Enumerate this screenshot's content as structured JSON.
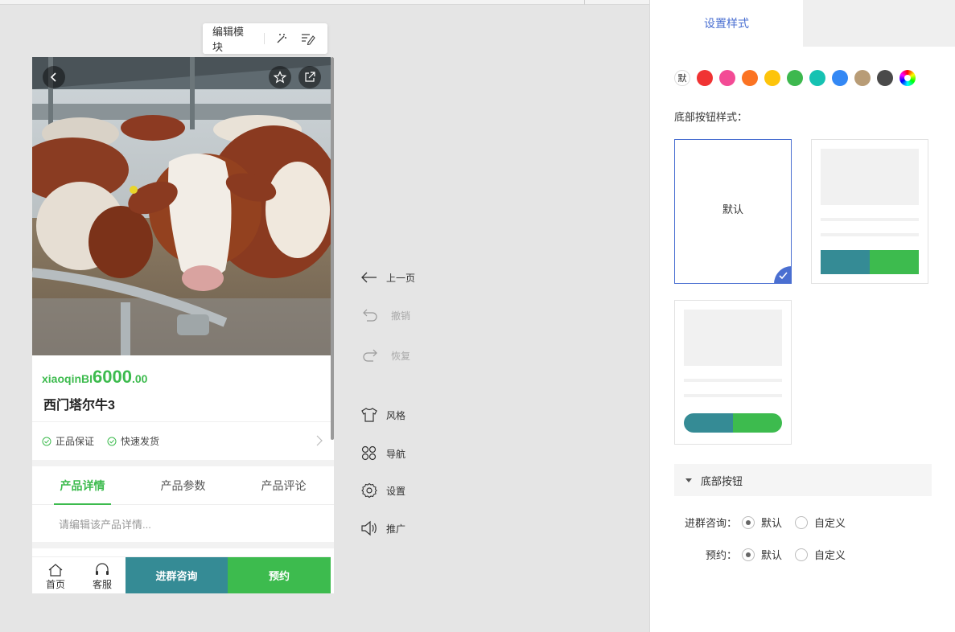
{
  "editor_toolbar": {
    "edit_module_label": "编辑模块",
    "icons": [
      "magic-wand-icon",
      "edit-list-icon"
    ]
  },
  "product": {
    "price_unit": "xiaoqinBI",
    "price_integer": "6000",
    "price_decimal": ".00",
    "title": "西门塔尔牛3",
    "guarantees": [
      "正品保证",
      "快速发货"
    ]
  },
  "tabs": [
    {
      "label": "产品详情",
      "active": true
    },
    {
      "label": "产品参数",
      "active": false
    },
    {
      "label": "产品评论",
      "active": false
    }
  ],
  "detail_placeholder": "请编辑该产品详情...",
  "bottom_bar": {
    "home_label": "首页",
    "service_label": "客服",
    "consult_label": "进群咨询",
    "reserve_label": "预约",
    "consult_color": "#358b95",
    "reserve_color": "#3dbb4e"
  },
  "side_actions": [
    {
      "label": "上一页",
      "icon": "arrow-left-icon",
      "enabled": true
    },
    {
      "label": "撤销",
      "icon": "undo-icon",
      "enabled": false
    },
    {
      "label": "恢复",
      "icon": "redo-icon",
      "enabled": false
    },
    {
      "label": "风格",
      "icon": "tshirt-icon",
      "enabled": true
    },
    {
      "label": "导航",
      "icon": "grid-nav-icon",
      "enabled": true
    },
    {
      "label": "设置",
      "icon": "gear-icon",
      "enabled": true
    },
    {
      "label": "推广",
      "icon": "speaker-icon",
      "enabled": true
    }
  ],
  "panel": {
    "tab_label": "设置样式",
    "default_swatch_label": "默",
    "swatch_colors": [
      "#f03333",
      "#f34b95",
      "#fb7322",
      "#fdc40b",
      "#3db84e",
      "#16c2b2",
      "#3388f4",
      "#b89c76",
      "#4a4a4a"
    ],
    "bottom_button_style_label": "底部按钮样式：",
    "card_default_label": "默认",
    "selected_card": 0,
    "section_title": "底部按钮",
    "rows": [
      {
        "label": "进群咨询：",
        "options": [
          "默认",
          "自定义"
        ],
        "selected": 0
      },
      {
        "label": "预约：",
        "options": [
          "默认",
          "自定义"
        ],
        "selected": 0
      }
    ]
  }
}
